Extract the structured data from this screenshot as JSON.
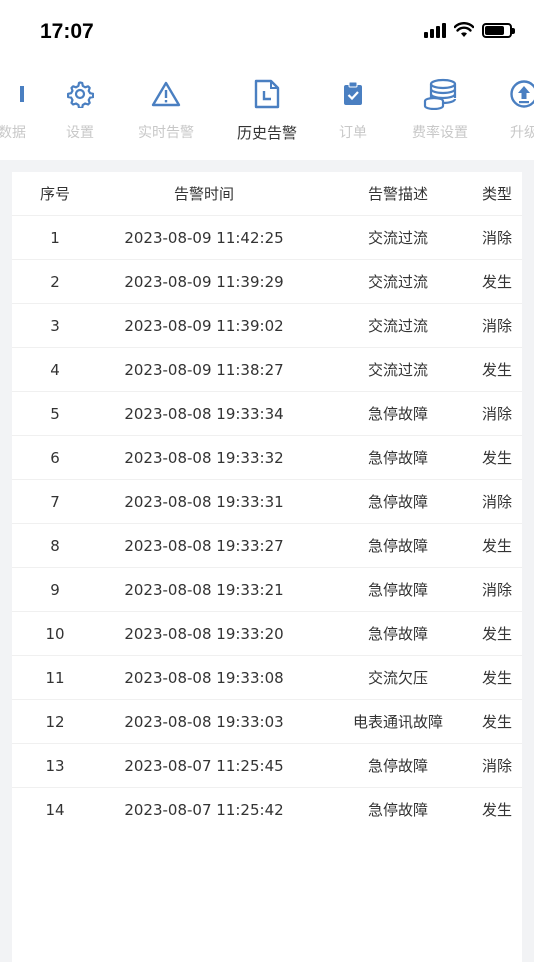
{
  "status": {
    "time": "17:07"
  },
  "tabs": [
    {
      "label": "数据",
      "icon": "data-icon",
      "active": false
    },
    {
      "label": "设置",
      "icon": "gear-icon",
      "active": false
    },
    {
      "label": "实时告警",
      "icon": "warning-icon",
      "active": false
    },
    {
      "label": "历史告警",
      "icon": "history-doc-icon",
      "active": true
    },
    {
      "label": "订单",
      "icon": "clipboard-check-icon",
      "active": false
    },
    {
      "label": "费率设置",
      "icon": "coins-stack-icon",
      "active": false
    },
    {
      "label": "升级",
      "icon": "upload-icon",
      "active": false
    }
  ],
  "table": {
    "headers": {
      "idx": "序号",
      "time": "告警时间",
      "desc": "告警描述",
      "type": "类型"
    },
    "rows": [
      {
        "idx": "1",
        "time": "2023-08-09 11:42:25",
        "desc": "交流过流",
        "type": "消除"
      },
      {
        "idx": "2",
        "time": "2023-08-09 11:39:29",
        "desc": "交流过流",
        "type": "发生"
      },
      {
        "idx": "3",
        "time": "2023-08-09 11:39:02",
        "desc": "交流过流",
        "type": "消除"
      },
      {
        "idx": "4",
        "time": "2023-08-09 11:38:27",
        "desc": "交流过流",
        "type": "发生"
      },
      {
        "idx": "5",
        "time": "2023-08-08 19:33:34",
        "desc": "急停故障",
        "type": "消除"
      },
      {
        "idx": "6",
        "time": "2023-08-08 19:33:32",
        "desc": "急停故障",
        "type": "发生"
      },
      {
        "idx": "7",
        "time": "2023-08-08 19:33:31",
        "desc": "急停故障",
        "type": "消除"
      },
      {
        "idx": "8",
        "time": "2023-08-08 19:33:27",
        "desc": "急停故障",
        "type": "发生"
      },
      {
        "idx": "9",
        "time": "2023-08-08 19:33:21",
        "desc": "急停故障",
        "type": "消除"
      },
      {
        "idx": "10",
        "time": "2023-08-08 19:33:20",
        "desc": "急停故障",
        "type": "发生"
      },
      {
        "idx": "11",
        "time": "2023-08-08 19:33:08",
        "desc": "交流欠压",
        "type": "发生"
      },
      {
        "idx": "12",
        "time": "2023-08-08 19:33:03",
        "desc": "电表通讯故障",
        "type": "发生"
      },
      {
        "idx": "13",
        "time": "2023-08-07 11:25:45",
        "desc": "急停故障",
        "type": "消除"
      },
      {
        "idx": "14",
        "time": "2023-08-07 11:25:42",
        "desc": "急停故障",
        "type": "发生"
      }
    ]
  },
  "colors": {
    "icon_blue": "#4a7fc1",
    "inactive_label": "#c8c8c8",
    "active_label": "#333333"
  }
}
